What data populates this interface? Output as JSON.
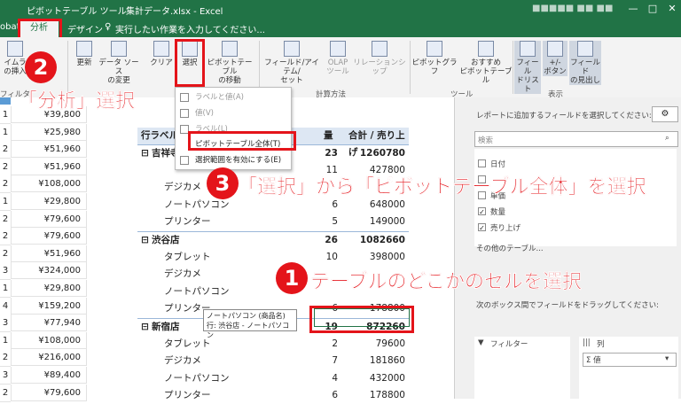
{
  "titlebar": {
    "tools_label": "ピボットテーブル ツール",
    "filename": "集計データ.xlsx - Excel",
    "search_hint": "実行したい作業を入力してください...",
    "user": "■■■■■ ■■ ■■"
  },
  "tabs": {
    "left_cut": "obat",
    "analyze": "分析",
    "design": "デザイン"
  },
  "ribbon": {
    "buttons": [
      {
        "label": "イムラ\nの挿入"
      },
      {
        "label": "更新"
      },
      {
        "label": "データ ソース\nの変更"
      },
      {
        "label": "クリア"
      },
      {
        "label": "選択"
      },
      {
        "label": "ピボットテーブル\nの移動"
      },
      {
        "label": "フィールド/アイテム/\nセット"
      },
      {
        "label": "OLAP\nツール"
      },
      {
        "label": "リレーションシップ"
      },
      {
        "label": "ピボットグラフ"
      },
      {
        "label": "おすすめ\nピボットテーブル"
      },
      {
        "label": "フィール\nドリスト"
      },
      {
        "label": "+/-\nボタン"
      },
      {
        "label": "フィールド\nの見出し"
      }
    ],
    "groups": {
      "filter": "フィルタ",
      "calc": "計算方法",
      "tools": "ツール",
      "show": "表示"
    }
  },
  "select_menu": {
    "items": [
      {
        "label": "ラベルと値(A)"
      },
      {
        "label": "値(V)"
      },
      {
        "label": "ラベル(L)"
      },
      {
        "label": "ピボットテーブル全体(T)"
      },
      {
        "label": "選択範囲を有効にする(E)"
      }
    ]
  },
  "sheet": {
    "rows": [
      {
        "n": "1",
        "price": "¥39,800"
      },
      {
        "n": "1",
        "price": "¥25,980"
      },
      {
        "n": "2",
        "price": "¥51,960"
      },
      {
        "n": "2",
        "price": "¥51,960"
      },
      {
        "n": "2",
        "price": "¥108,000"
      },
      {
        "n": "1",
        "price": "¥29,800"
      },
      {
        "n": "2",
        "price": "¥79,600"
      },
      {
        "n": "2",
        "price": "¥79,600"
      },
      {
        "n": "2",
        "price": "¥51,960"
      },
      {
        "n": "3",
        "price": "¥324,000"
      },
      {
        "n": "1",
        "price": "¥29,800"
      },
      {
        "n": "4",
        "price": "¥159,200"
      },
      {
        "n": "3",
        "price": "¥77,940"
      },
      {
        "n": "1",
        "price": "¥108,000"
      },
      {
        "n": "2",
        "price": "¥216,000"
      },
      {
        "n": "3",
        "price": "¥89,400"
      },
      {
        "n": "2",
        "price": "¥79,600"
      }
    ],
    "pivot": {
      "header": {
        "label": "行ラベル",
        "qty": "量",
        "sales": "合計 / 売り上げ"
      },
      "rows": [
        {
          "label": "吉祥寺",
          "qty": "23",
          "sales": "1260780",
          "group": true
        },
        {
          "label": "",
          "qty": "11",
          "sales": "427800"
        },
        {
          "label": "デジカメ",
          "qty": "",
          "sales": ""
        },
        {
          "label": "ノートパソコン",
          "qty": "6",
          "sales": "648000"
        },
        {
          "label": "プリンター",
          "qty": "5",
          "sales": "149000"
        },
        {
          "label": "渋谷店",
          "qty": "26",
          "sales": "1082660",
          "group": true
        },
        {
          "label": "タブレット",
          "qty": "10",
          "sales": "398000"
        },
        {
          "label": "デジカメ",
          "qty": "",
          "sales": ""
        },
        {
          "label": "ノートパソコン",
          "qty": "",
          "sales": ""
        },
        {
          "label": "プリンター",
          "qty": "6",
          "sales": "178800"
        },
        {
          "label": "新宿店",
          "qty": "19",
          "sales": "872260",
          "group": true
        },
        {
          "label": "タブレット",
          "qty": "2",
          "sales": "79600"
        },
        {
          "label": "デジカメ",
          "qty": "7",
          "sales": "181860"
        },
        {
          "label": "ノートパソコン",
          "qty": "4",
          "sales": "432000"
        },
        {
          "label": "プリンター",
          "qty": "6",
          "sales": "178800"
        }
      ]
    },
    "tooltip": {
      "line1": "ノートパソコン (商品名)",
      "line2": "行: 渋谷店 - ノートパソコン"
    }
  },
  "annotations": {
    "step1_num": "1",
    "step1_text": "テーブルのどこかのセルを選択",
    "step2_num": "2",
    "step2_text": "「分析」選択",
    "step3_num": "3",
    "step3_text": "「選択」から「ピボットテーブル全体」を選択",
    "color": "#e4141a"
  },
  "field_pane": {
    "instruction": "レポートに追加するフィールドを選択してください:",
    "search_placeholder": "検索",
    "fields": [
      {
        "label": "日付",
        "checked": false
      },
      {
        "label": "",
        "checked": false
      },
      {
        "label": "単価",
        "checked": false
      },
      {
        "label": "数量",
        "checked": true
      },
      {
        "label": "売り上げ",
        "checked": true
      }
    ],
    "more_tables": "その他のテーブル...",
    "drag_instruction": "次のボックス間でフィールドをドラッグしてください:",
    "filter_area": "フィルター",
    "column_area": "列",
    "values_item": "Σ 値"
  },
  "colors": {
    "excel_green": "#217346",
    "highlight_red": "#e4141a"
  }
}
